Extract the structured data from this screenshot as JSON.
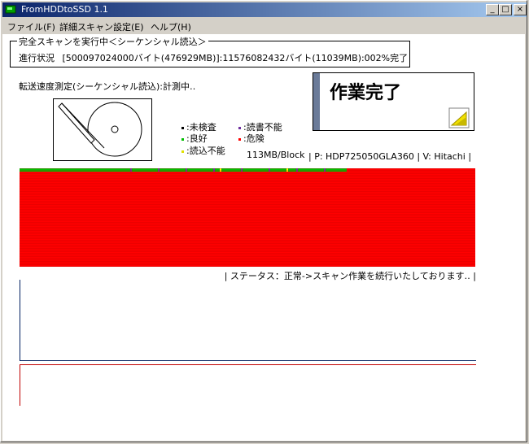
{
  "window": {
    "title": "FromHDDtoSSD  1.1",
    "buttons": {
      "minimize": "_",
      "maximize": "□",
      "close": "×"
    }
  },
  "menu": {
    "items": [
      "ファイル(F)",
      "詳細スキャン設定(E)",
      "ヘルプ(H)"
    ]
  },
  "scan": {
    "legend": "完全スキャンを実行中＜シーケンシャル読込＞",
    "progress_label": "進行状況",
    "progress_text": "[500097024000バイト(476929MB)]:11576082432バイト(11039MB):002%完了",
    "percent_done": 2
  },
  "speed_text": "転送速度測定(シーケンシャル読込):計測中‥",
  "done_panel": {
    "text": "作業完了"
  },
  "legend_items": [
    {
      "label": ":未検査",
      "color": "#000000"
    },
    {
      "label": ":読書不能",
      "color": "#7030a0"
    },
    {
      "label": ":良好",
      "color": "#00c000"
    },
    {
      "label": ":危険",
      "color": "#ff0000"
    },
    {
      "label": ":読込不能",
      "color": "#ffff00"
    }
  ],
  "block_size": "113MB/Block",
  "model": "| P:  HDP725050GLA360  | V: Hitachi |",
  "status": "| ステータス：正常->スキャン作業を続行いたしております‥ |",
  "colors": {
    "map_bg": "#ff0000",
    "good": "#00c000",
    "bad": "#7030a0",
    "unread": "#ffff00"
  }
}
